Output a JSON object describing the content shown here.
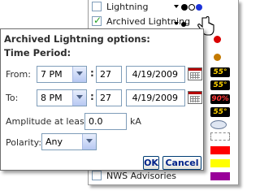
{
  "layers": {
    "lightning": {
      "label": "Lightning",
      "checked": false
    },
    "archived": {
      "label": "Archived Lightning",
      "checked": true
    },
    "nws_advisories": {
      "label": "NWS Advisories",
      "checked": false
    },
    "badge_text_1": "55°",
    "badge_text_2": "55°",
    "badge_text_3": "90%",
    "badge_text_4": "55°"
  },
  "dialog": {
    "title": "Archived Lightning options:",
    "time_period_label": "Time Period:",
    "from": {
      "label": "From:",
      "hour": "7 PM",
      "colon": ":",
      "minute": "27",
      "date": "4/19/2009"
    },
    "to": {
      "label": "To:",
      "hour": "8 PM",
      "colon": ":",
      "minute": "27",
      "date": "4/19/2009"
    },
    "amplitude": {
      "label": "Amplitude at least:",
      "value": "0.0",
      "unit": "kA"
    },
    "polarity": {
      "label": "Polarity:",
      "value": "Any"
    },
    "ok_label": "OK",
    "cancel_label": "Cancel"
  },
  "colors": {
    "accent_blue": "#1d33d8",
    "check_green": "#21a121",
    "button_text": "#00238a",
    "red_bar": "#ff0000",
    "yellow_bar": "#ffff00",
    "purple_bar": "#990099"
  }
}
